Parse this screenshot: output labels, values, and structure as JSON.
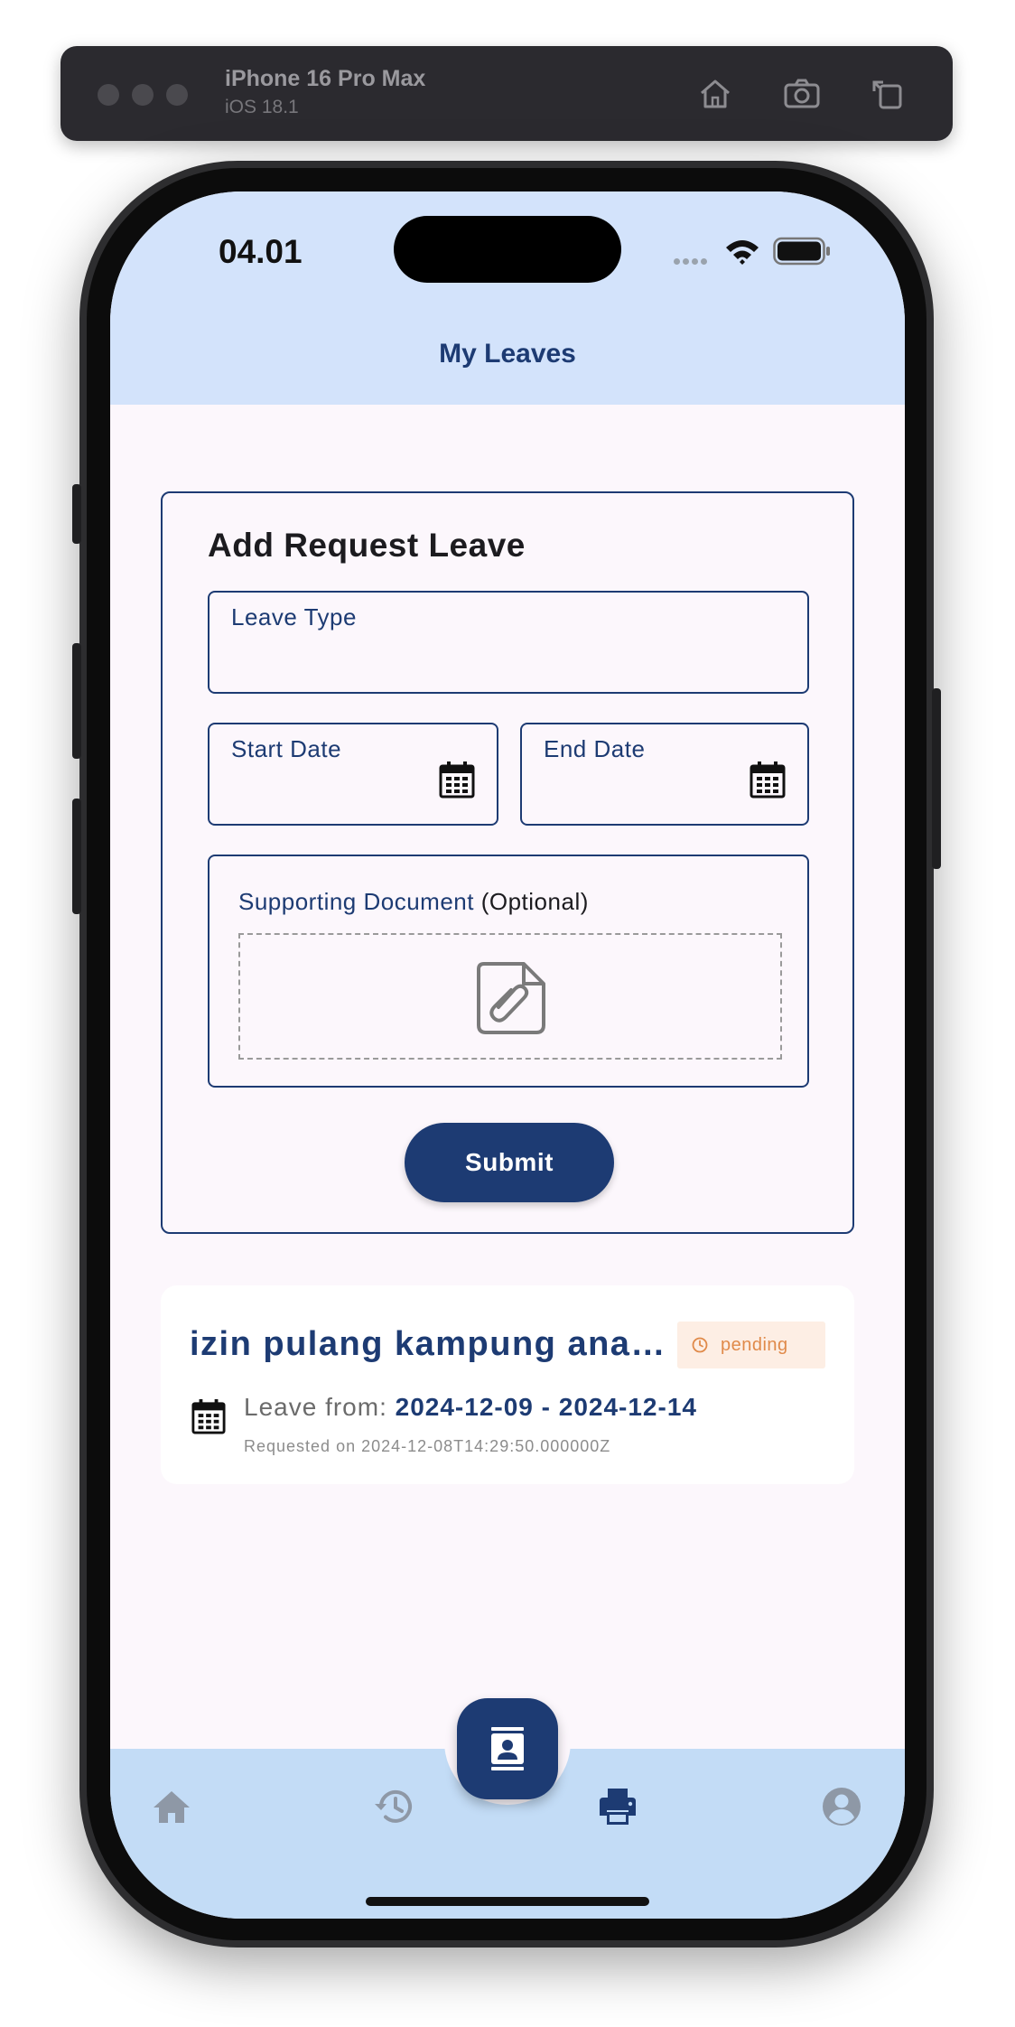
{
  "simulator": {
    "device": "iPhone 16 Pro Max",
    "os": "iOS 18.1",
    "icons": [
      "home-icon",
      "screenshot-icon",
      "rotate-icon"
    ]
  },
  "status_bar": {
    "time": "04.01",
    "icons": [
      "wifi-icon",
      "battery-icon"
    ]
  },
  "header": {
    "title": "My Leaves"
  },
  "form": {
    "title": "Add Request Leave",
    "leave_type_label": "Leave Type",
    "start_date_label": "Start Date",
    "end_date_label": "End Date",
    "supporting_doc_label": "Supporting Document",
    "optional_label": "(Optional)",
    "submit_label": "Submit"
  },
  "leave_requests": [
    {
      "title": "izin pulang kampung ana…",
      "status": "pending",
      "leave_from_label": "Leave from:",
      "dates": "2024-12-09 - 2024-12-14",
      "requested": "Requested on 2024-12-08T14:29:50.000000Z"
    }
  ],
  "bottom_nav": {
    "items": [
      "home-icon",
      "history-icon",
      "contact-badge-icon",
      "print-icon",
      "account-icon"
    ],
    "active": "print-icon",
    "colors": {
      "active": "#1d3b73",
      "inactive": "#8e98a6",
      "background": "#c3dcf6"
    }
  },
  "colors": {
    "primary": "#1d3b73",
    "header_bg": "#d3e3fb",
    "page_bg": "#fcf7fc",
    "pending": "#e08a4a",
    "pending_bg": "#fdeee4"
  }
}
